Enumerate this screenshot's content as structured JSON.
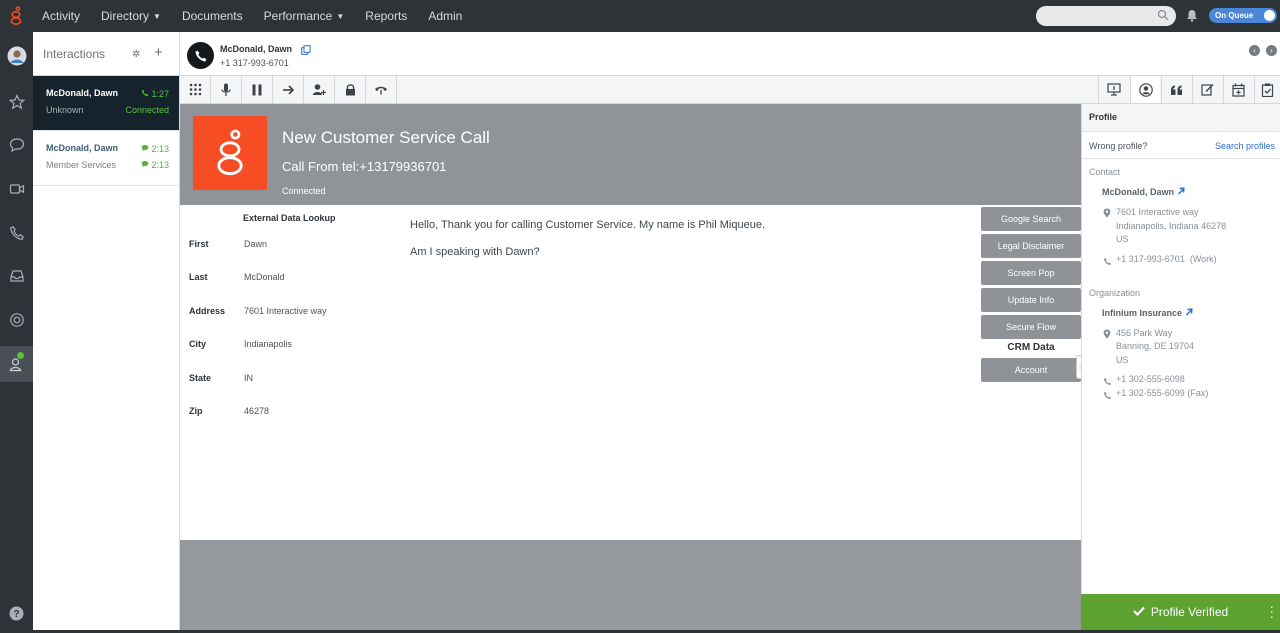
{
  "nav": {
    "items": [
      {
        "label": "Activity",
        "caret": false
      },
      {
        "label": "Directory",
        "caret": true
      },
      {
        "label": "Documents",
        "caret": false
      },
      {
        "label": "Performance",
        "caret": true
      },
      {
        "label": "Reports",
        "caret": false
      },
      {
        "label": "Admin",
        "caret": false
      }
    ],
    "search_placeholder": "",
    "queue_label": "On Queue"
  },
  "interactions": {
    "title": "Interactions",
    "cards": [
      {
        "name": "McDonald, Dawn",
        "sub": "Unknown",
        "time": "1:27",
        "status": "Connected",
        "active": true,
        "icon": "phone-icon"
      },
      {
        "name": "McDonald, Dawn",
        "sub": "Member Services",
        "time": "2:13",
        "status": "2:13",
        "active": false,
        "icon": "chat-icon"
      }
    ]
  },
  "header": {
    "name": "McDonald, Dawn",
    "phone": "+1 317-993-6701"
  },
  "script": {
    "banner_title": "New Customer Service Call",
    "banner_sub": "Call From tel:+13179936701",
    "banner_status": "Connected",
    "lookup_title": "External Data Lookup",
    "lookup": [
      {
        "label": "First",
        "value": "Dawn"
      },
      {
        "label": "Last",
        "value": "McDonald"
      },
      {
        "label": "Address",
        "value": "7601 Interactive way"
      },
      {
        "label": "City",
        "value": "Indianapolis"
      },
      {
        "label": "State",
        "value": "IN"
      },
      {
        "label": "Zip",
        "value": "46278"
      }
    ],
    "lines": [
      "Hello, Thank you for calling Customer Service. My name is Phil Miqueue.",
      "Am I speaking with Dawn?"
    ],
    "buttons": [
      "Google Search",
      "Legal Disclaimer",
      "Screen Pop",
      "Update Info",
      "Secure Flow"
    ],
    "crm_label": "CRM Data",
    "crm_button": "Account"
  },
  "profile": {
    "title": "Profile",
    "wrong": "Wrong profile?",
    "search": "Search profiles",
    "contact_section": "Contact",
    "contact_name": "McDonald, Dawn",
    "contact_addr1": "7601 Interactive way",
    "contact_addr2": "Indianapolis, Indiana 46278",
    "contact_addr3": "US",
    "contact_phone": "+1 317-993-6701",
    "contact_phone_type": "(Work)",
    "org_section": "Organization",
    "org_name": "Infinium Insurance",
    "org_addr1": "456 Park Way",
    "org_addr2": "Banning, DE 19704",
    "org_addr3": "US",
    "org_phone1": "+1 302-555-6098",
    "org_phone2": "+1 302-555-6099",
    "org_phone2_type": "(Fax)",
    "verified_label": "Profile Verified"
  },
  "colors": {
    "brand": "#f64d25",
    "nav_bg": "#2e3338",
    "connected": "#58c43b",
    "verified": "#5ea232",
    "link": "#2a6fd6"
  }
}
